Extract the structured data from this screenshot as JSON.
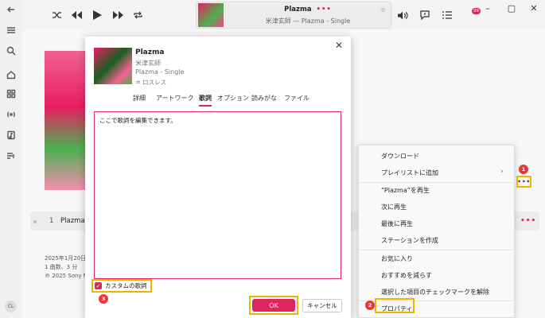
{
  "now_playing": {
    "title": "Plazma",
    "more": "•••",
    "subtitle": "米津玄師 — Plazma - Single",
    "star": "☆"
  },
  "badge_count": "99",
  "track": {
    "number": "1",
    "name": "Plazma",
    "more": "•••"
  },
  "meta": {
    "date": "2025年1月20日",
    "count": "1 曲数、3 分",
    "copyright": "℗ 2025 Sony M"
  },
  "avatar": "CL",
  "dialog": {
    "close": "✕",
    "title": "Plazma",
    "artist": "米津玄師",
    "album": "Plazma - Single",
    "lossless": "ロスレス",
    "tabs": [
      "詳細",
      "アートワーク",
      "歌詞",
      "オプション",
      "読みがな",
      "ファイル"
    ],
    "active_tab": "歌詞",
    "lyrics_value": "ここで歌詞を編集できます。",
    "custom_lyrics_label": "カスタムの歌詞",
    "custom_lyrics_checked": true,
    "ok_label": "OK",
    "cancel_label": "キャンセル"
  },
  "menu": {
    "items": [
      "ダウンロード",
      "プレイリストに追加",
      "“Plazma”を再生",
      "次に再生",
      "最後に再生",
      "ステーションを作成",
      "お気に入り",
      "おすすめを減らす",
      "選択した項目のチェックマークを解除",
      "プロパティ"
    ]
  },
  "more_button": "•••",
  "markers": [
    "1",
    "2",
    "3"
  ],
  "colors": {
    "accent": "#e0245e",
    "highlight": "#f0b400",
    "marker": "#e53935"
  }
}
